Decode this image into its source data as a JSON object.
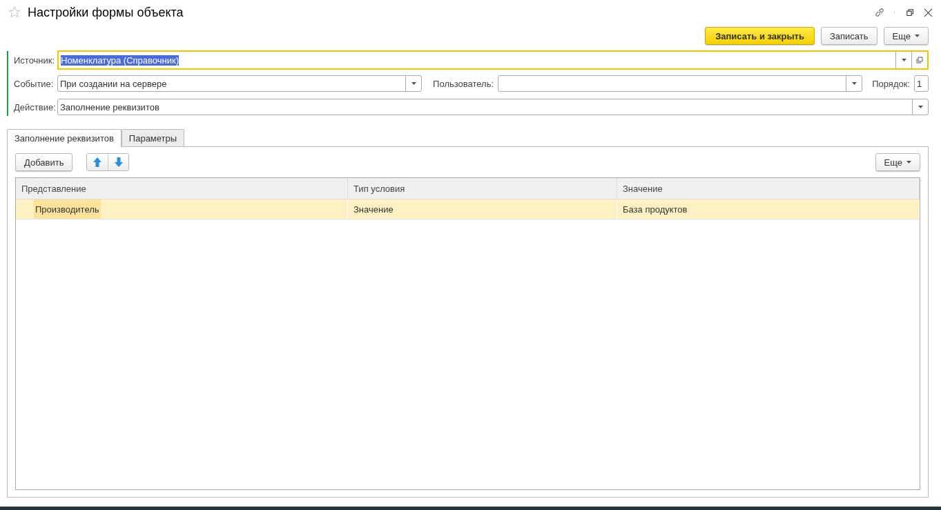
{
  "window": {
    "title": "Настройки формы объекта",
    "favorite": false
  },
  "toolbar": {
    "buttons": [
      {
        "label": "Записать и закрыть",
        "kind": "primary"
      },
      {
        "label": "Записать",
        "kind": "normal"
      },
      {
        "label": "Еще",
        "kind": "menu"
      }
    ]
  },
  "fields": [
    {
      "label": "Источник:",
      "value": "Номенклатура (Справочник)",
      "focused": true,
      "kind": "open"
    },
    {
      "label": "Событие:",
      "value": "При создании на сервере",
      "focused": false,
      "kind": "dropdown"
    },
    {
      "label": "Пользователь:",
      "focused": false,
      "kind": "dropdown"
    },
    {
      "label": "Порядок:",
      "value": "1",
      "focused": false,
      "kind": "plain"
    },
    {
      "label": "Действие:",
      "value": "Заполнение реквизитов",
      "focused": false,
      "kind": "dropdown"
    }
  ],
  "tabs": [
    {
      "label": "Заполнение реквизитов",
      "selected": true
    },
    {
      "label": "Параметры",
      "selected": false
    }
  ],
  "table_toolbar": {
    "add": "Добавить",
    "more": "Еще"
  },
  "table": {
    "columns": [
      "Представление",
      "Тип условия",
      "Значение"
    ],
    "rows": [
      {
        "cells": [
          "Производитель",
          "Значение",
          "База продуктов"
        ],
        "selected": true
      }
    ]
  }
}
